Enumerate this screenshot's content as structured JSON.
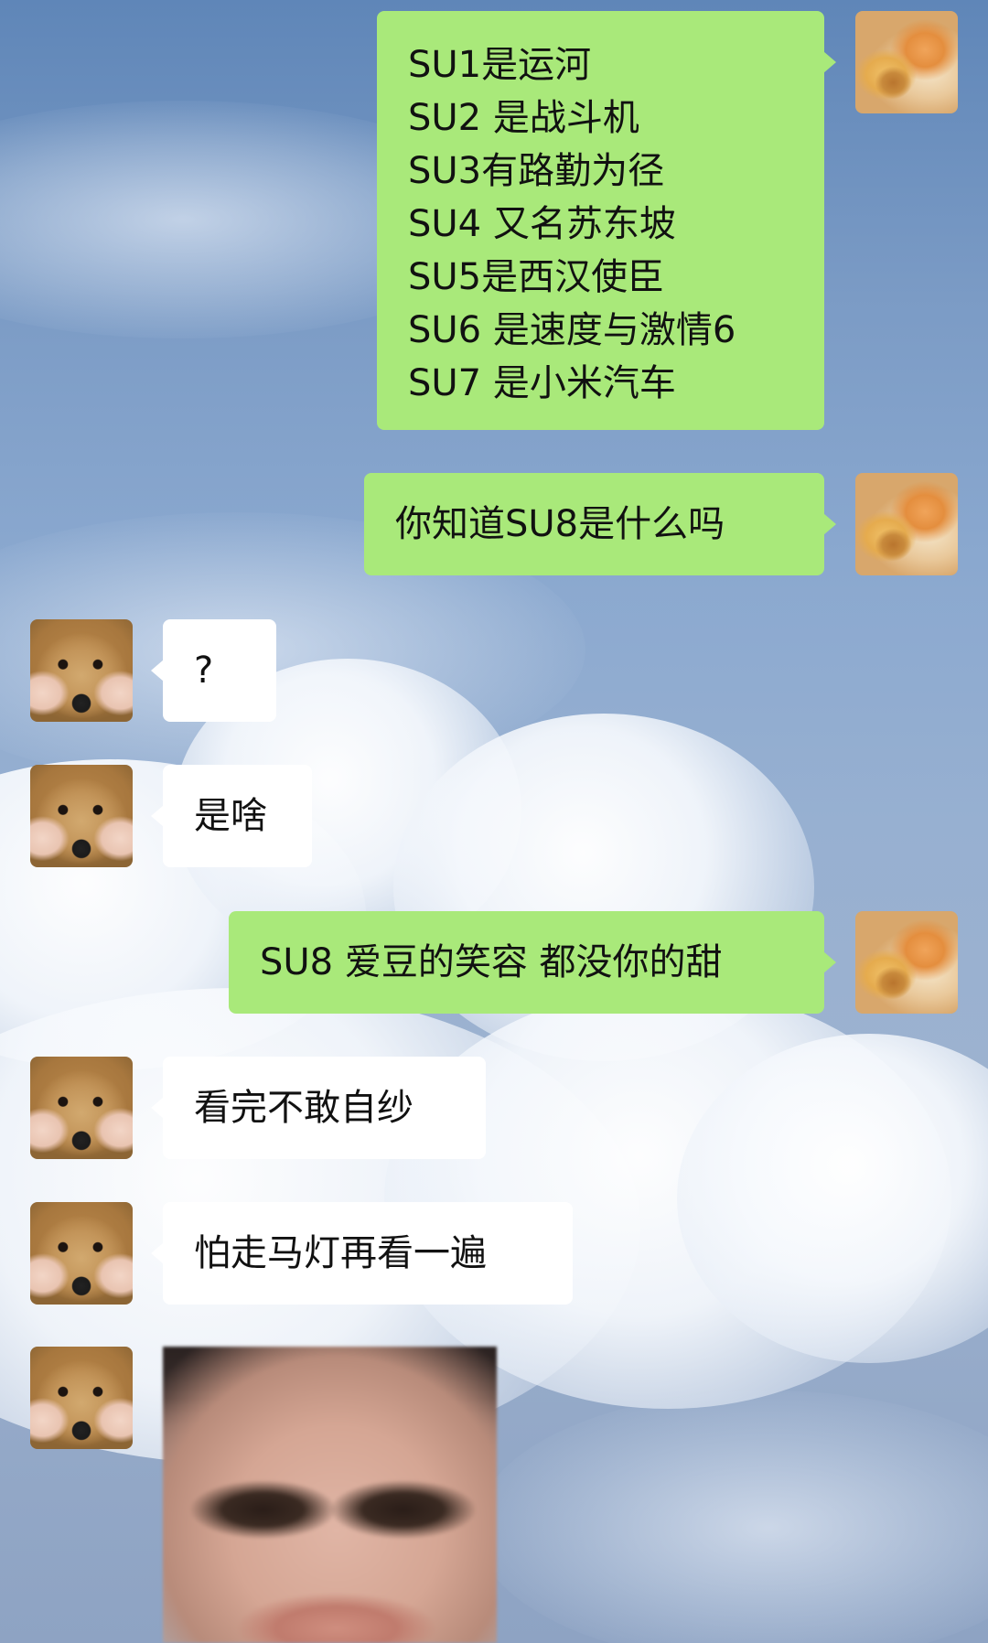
{
  "chat": {
    "messages": [
      {
        "id": "msg-1",
        "sender": "self",
        "lines": [
          "SU1是运河",
          "SU2 是战斗机",
          "SU3有路勤为径",
          "SU4 又名苏东坡",
          "SU5是西汉使臣",
          "SU6 是速度与激情6",
          "SU7 是小米汽车"
        ]
      },
      {
        "id": "msg-2",
        "sender": "self",
        "text": "你知道SU8是什么吗"
      },
      {
        "id": "msg-3",
        "sender": "other",
        "text": "?"
      },
      {
        "id": "msg-4",
        "sender": "other",
        "text": "是啥"
      },
      {
        "id": "msg-5",
        "sender": "self",
        "text": "SU8 爱豆的笑容 都没你的甜"
      },
      {
        "id": "msg-6",
        "sender": "other",
        "text": "看完不敢自纱"
      },
      {
        "id": "msg-7",
        "sender": "other",
        "text": "怕走马灯再看一遍"
      },
      {
        "id": "msg-8",
        "sender": "other",
        "type": "image",
        "image_subject": "blurry-smiling-face-photo"
      }
    ]
  },
  "avatars": {
    "self": "cat-with-bread-avatar",
    "other": "dog-face-held-by-hands-avatar"
  },
  "colors": {
    "outgoing_bubble": "#a9e97a",
    "incoming_bubble": "#ffffff",
    "text": "#111111"
  }
}
